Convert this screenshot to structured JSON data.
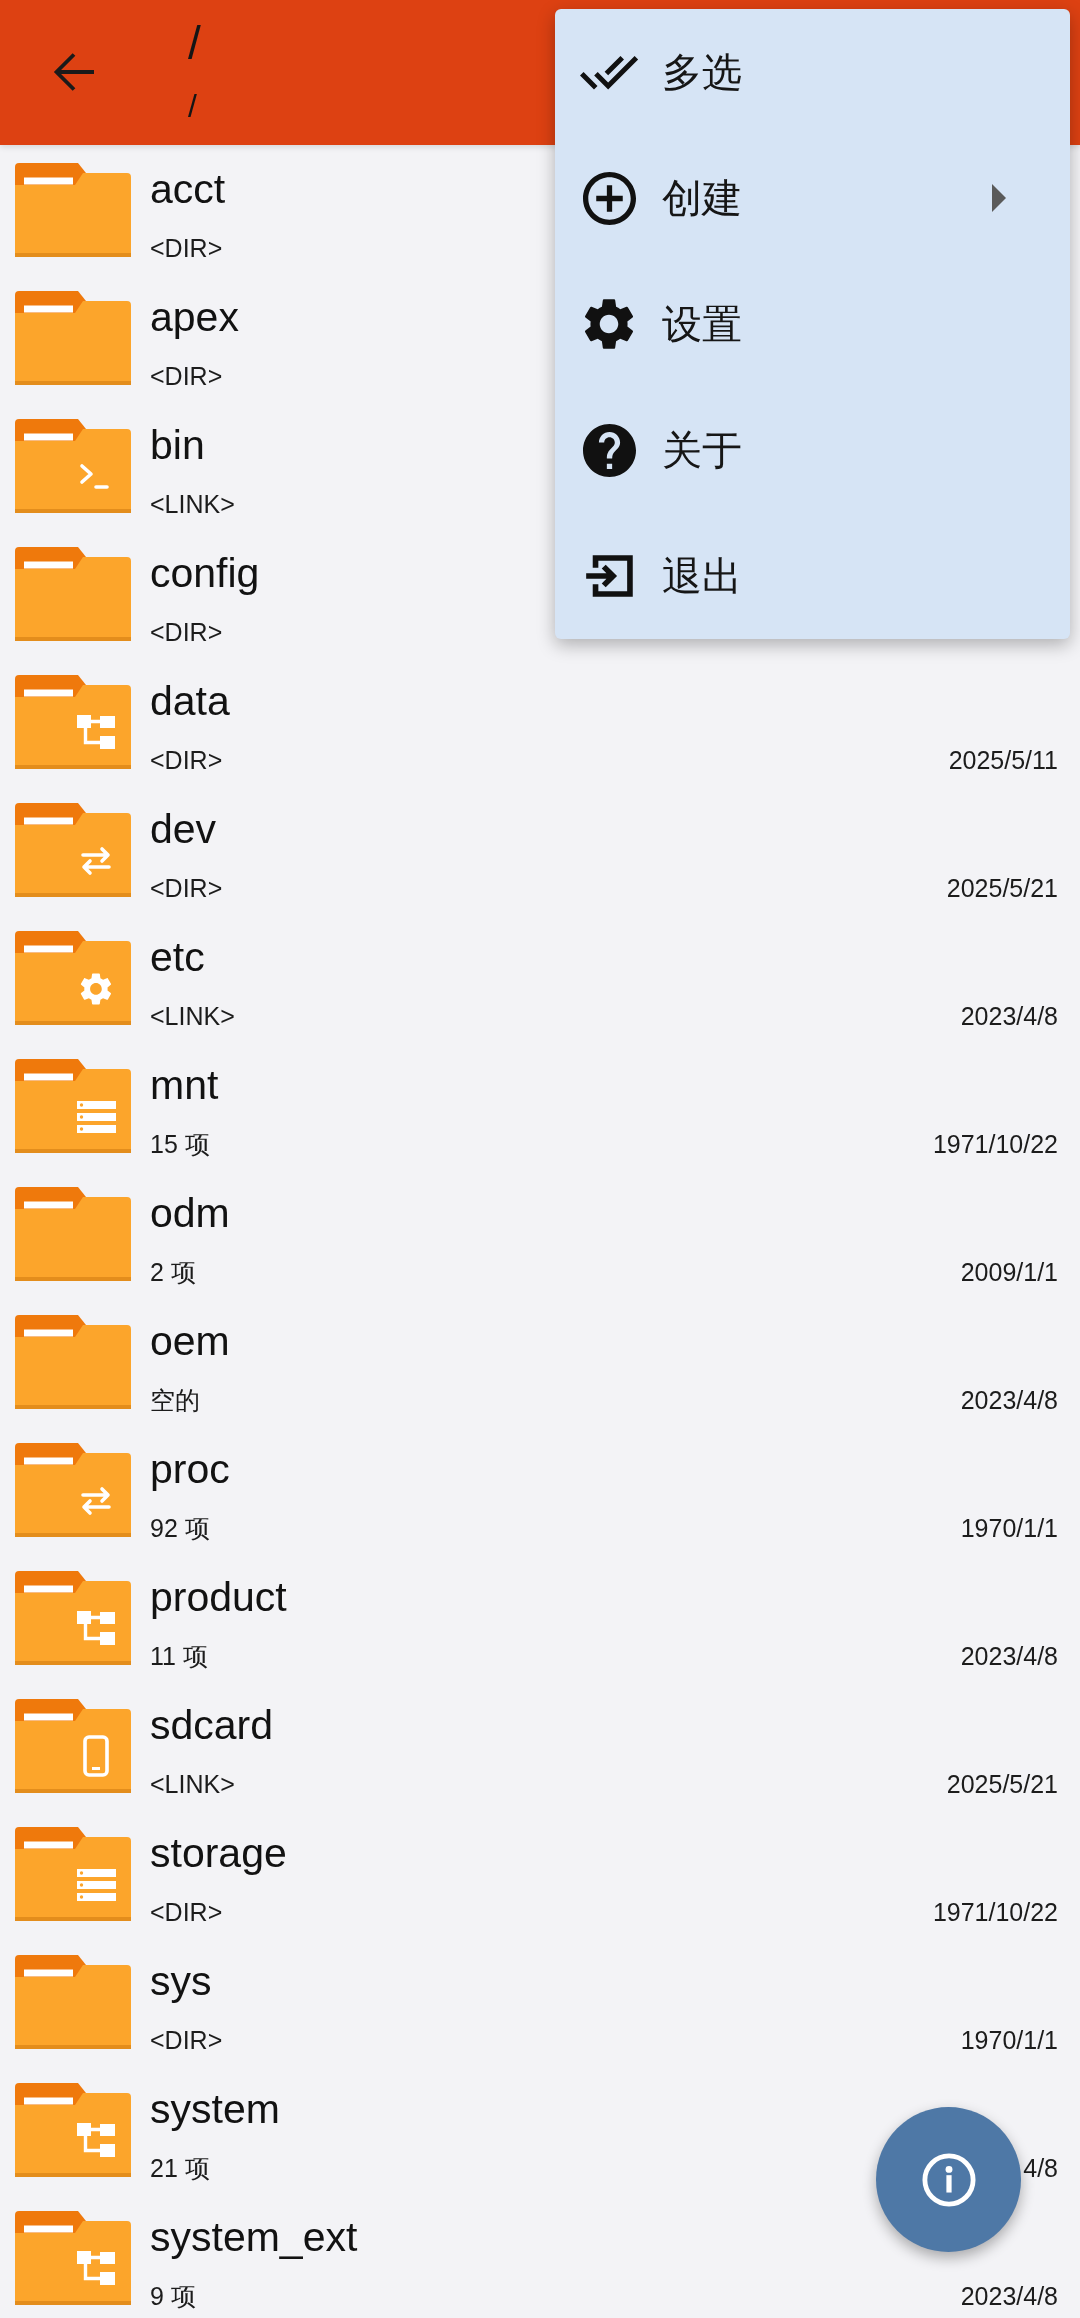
{
  "app_bar": {
    "title": "/",
    "subtitle": "/"
  },
  "files": [
    {
      "name": "acct",
      "info": "<DIR>",
      "kind": "plain"
    },
    {
      "name": "apex",
      "info": "<DIR>",
      "kind": "plain"
    },
    {
      "name": "bin",
      "info": "<LINK>",
      "kind": "terminal"
    },
    {
      "name": "config",
      "info": "<DIR>",
      "kind": "plain"
    },
    {
      "name": "data",
      "info": "<DIR>",
      "date": "2025/5/11",
      "kind": "tree"
    },
    {
      "name": "dev",
      "info": "<DIR>",
      "date": "2025/5/21",
      "kind": "swap"
    },
    {
      "name": "etc",
      "info": "<LINK>",
      "date": "2023/4/8",
      "kind": "gear"
    },
    {
      "name": "mnt",
      "info": "15 项",
      "date": "1971/10/22",
      "kind": "storage"
    },
    {
      "name": "odm",
      "info": "2 项",
      "date": "2009/1/1",
      "kind": "plain"
    },
    {
      "name": "oem",
      "info": "空的",
      "date": "2023/4/8",
      "kind": "plain"
    },
    {
      "name": "proc",
      "info": "92 项",
      "date": "1970/1/1",
      "kind": "swap"
    },
    {
      "name": "product",
      "info": "11 项",
      "date": "2023/4/8",
      "kind": "tree"
    },
    {
      "name": "sdcard",
      "info": "<LINK>",
      "date": "2025/5/21",
      "kind": "phone"
    },
    {
      "name": "storage",
      "info": "<DIR>",
      "date": "1971/10/22",
      "kind": "storage"
    },
    {
      "name": "sys",
      "info": "<DIR>",
      "date": "1970/1/1",
      "kind": "plain"
    },
    {
      "name": "system",
      "info": "21 项",
      "date": "4/8",
      "kind": "tree"
    },
    {
      "name": "system_ext",
      "info": "9 项",
      "date": "2023/4/8",
      "kind": "tree"
    }
  ],
  "overflow_menu": {
    "items": [
      {
        "label": "多选",
        "submenu": false
      },
      {
        "label": "创建",
        "submenu": true
      },
      {
        "label": "设置",
        "submenu": false
      },
      {
        "label": "关于",
        "submenu": false
      },
      {
        "label": "退出",
        "submenu": false
      }
    ]
  }
}
